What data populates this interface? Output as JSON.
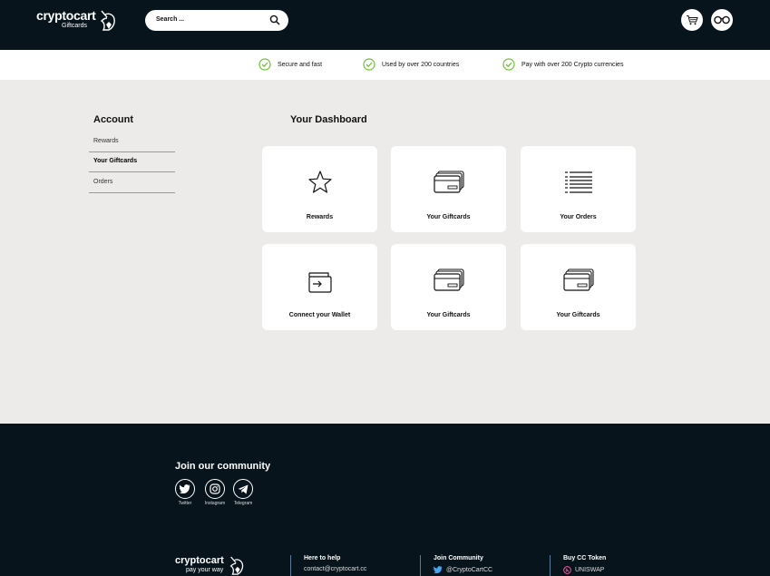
{
  "header": {
    "brand": "cryptocart",
    "brand_sub": "Giftcards",
    "search_placeholder": "Search ...",
    "icons": [
      "unicorn-logo",
      "search-icon",
      "cart-icon",
      "glasses-icon"
    ]
  },
  "features": [
    {
      "label": "Secure and fast",
      "icon": "check-circle-icon"
    },
    {
      "label": "Used by over 200 countries",
      "icon": "check-circle-icon"
    },
    {
      "label": "Pay with over 200 Crypto currencies",
      "icon": "check-circle-icon"
    }
  ],
  "colors": {
    "accent": "#6ec231",
    "dark": "#07141c",
    "background": "#edebe9"
  },
  "sidebar": {
    "title": "Account",
    "items": [
      {
        "label": "Rewards",
        "active": false
      },
      {
        "label": "Your Giftcards",
        "active": true
      },
      {
        "label": "Orders",
        "active": false
      }
    ]
  },
  "dashboard": {
    "title": "Your Dashboard",
    "cards": [
      {
        "label": "Rewards",
        "icon": "star-icon"
      },
      {
        "label": "Your Giftcards",
        "icon": "cards-icon"
      },
      {
        "label": "Your Orders",
        "icon": "list-icon"
      },
      {
        "label": "Connect your Wallet",
        "icon": "wallet-icon"
      },
      {
        "label": "Your Giftcards",
        "icon": "cards-icon"
      },
      {
        "label": "Your Giftcards",
        "icon": "cards-icon"
      }
    ]
  },
  "footer": {
    "join_title": "Join our community",
    "socials": [
      {
        "label": "Twitter",
        "icon": "twitter-icon"
      },
      {
        "label": "Instagram",
        "icon": "instagram-icon"
      },
      {
        "label": "Telegram",
        "icon": "telegram-icon"
      }
    ],
    "brand": "cryptocart",
    "tagline": "pay your way",
    "columns": [
      {
        "heading": "Here to help",
        "value": "contact@cryptocart.cc"
      },
      {
        "heading": "Join Community",
        "value": "@CryptoCartCC",
        "icon": "twitter-icon"
      },
      {
        "heading": "Buy CC Token",
        "value": "UNISWAP",
        "icon": "uniswap-icon"
      }
    ]
  }
}
